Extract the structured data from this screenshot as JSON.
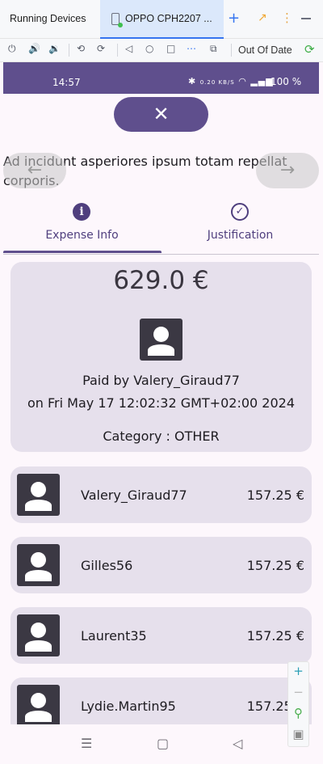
{
  "ide": {
    "window_title": "Running Devices",
    "device_tab": "OPPO CPH2207 ...",
    "add_label": "+",
    "toolbar_status": "Out Of Date"
  },
  "status_bar": {
    "time": "14:57",
    "network_speed": "0.20 KB/S",
    "battery": "100 %"
  },
  "app": {
    "close_label": "✕",
    "prev_label": "←",
    "next_label": "→",
    "description": "Ad incidunt asperiores ipsum totam repellat corporis.",
    "tabs": [
      {
        "label": "Expense Info",
        "icon": "info-icon",
        "selected": true
      },
      {
        "label": "Justification",
        "icon": "check-circle-icon",
        "selected": false
      }
    ],
    "summary": {
      "amount": "629.0 €",
      "paid_by": "Paid by Valery_Giraud77",
      "date": "on Fri May 17 12:02:32 GMT+02:00 2024",
      "category": "Category : OTHER"
    },
    "members": [
      {
        "name": "Valery_Giraud77",
        "amount": "157.25 €"
      },
      {
        "name": "Gilles56",
        "amount": "157.25 €"
      },
      {
        "name": "Laurent35",
        "amount": "157.25 €"
      },
      {
        "name": "Lydie.Martin95",
        "amount": "157.25 €"
      }
    ]
  },
  "colors": {
    "primary": "#5f4f8d",
    "card": "#e6e0ec",
    "background": "#fdf7fc"
  }
}
